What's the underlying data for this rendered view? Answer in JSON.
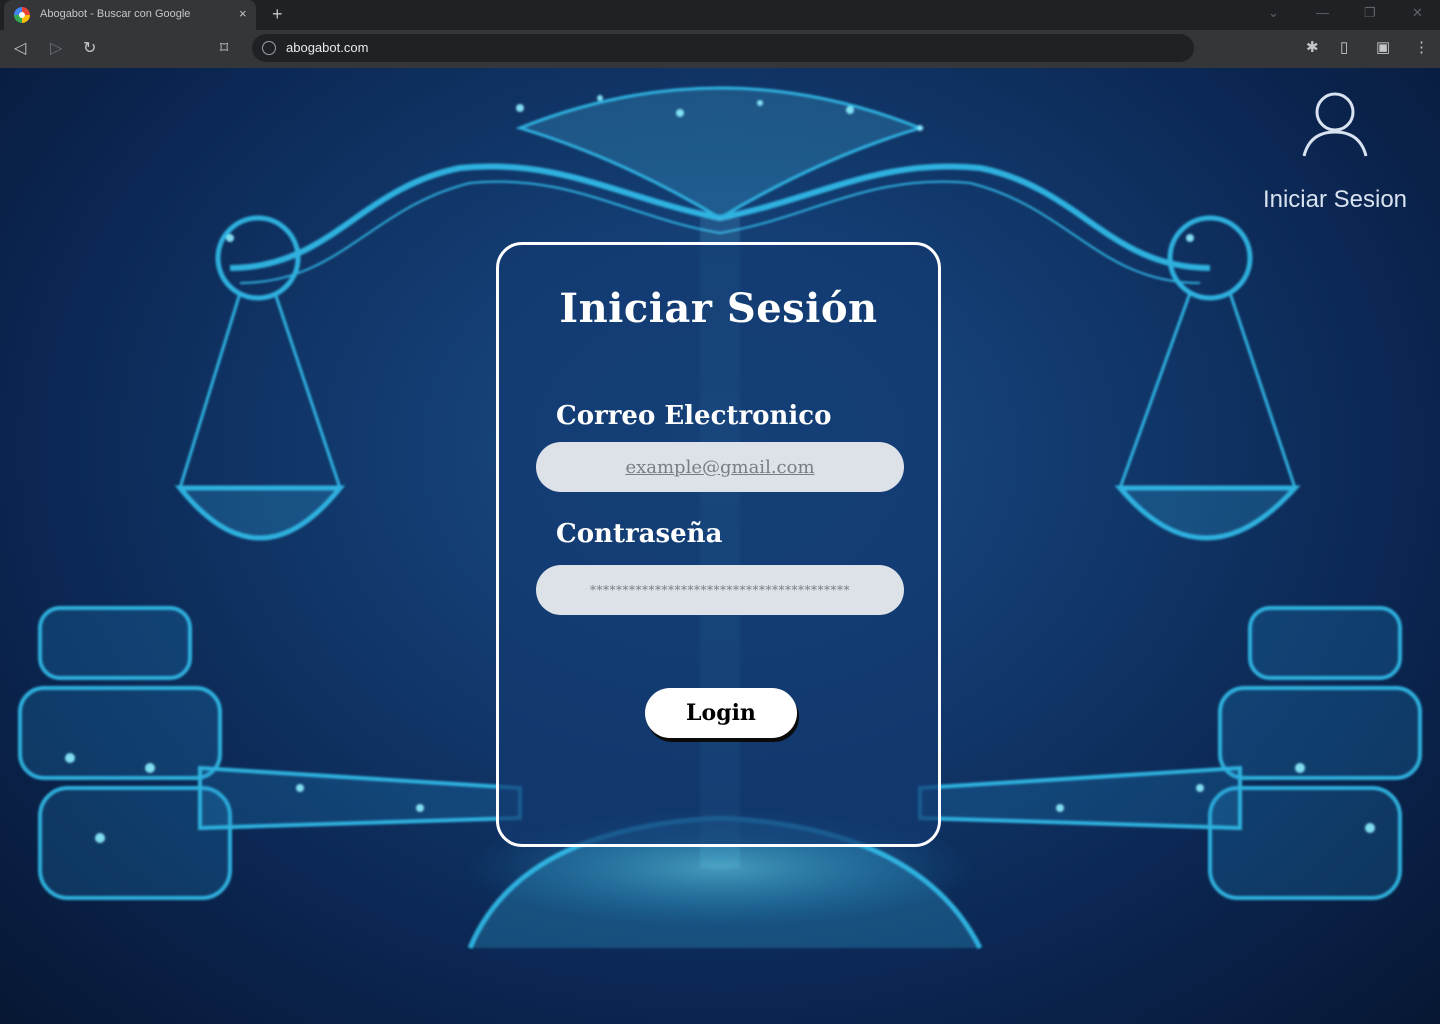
{
  "browser": {
    "tab": {
      "title": "Abogabot - Buscar con Google",
      "close_icon": "×"
    },
    "new_tab_icon": "+",
    "address": {
      "url": "abogabot.com"
    }
  },
  "header": {
    "account": {
      "label": "Iniciar Sesion",
      "icon": "user-icon"
    }
  },
  "login_form": {
    "title": "Iniciar Sesión",
    "email_label": "Correo Electronico",
    "email_placeholder": "example@gmail.com",
    "password_label": "Contraseña",
    "password_placeholder": "****************************************",
    "submit_label": "Login"
  },
  "colors": {
    "accent": "#3ad6ff",
    "background": "#0b2550",
    "card_border": "#ffffff",
    "input_bg": "#dde1e8"
  }
}
